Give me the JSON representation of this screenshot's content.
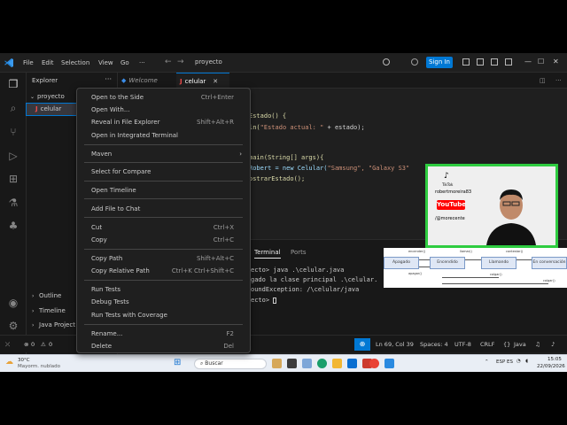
{
  "titlebar": {
    "menus": [
      "File",
      "Edit",
      "Selection",
      "View",
      "Go"
    ],
    "search_text": "proyecto",
    "sign_in": "Sign In"
  },
  "sidebar": {
    "title": "Explorer",
    "folder": "proyecto",
    "file_badge": "J",
    "file": "celular",
    "outline": "Outline",
    "timeline": "Timeline",
    "java_projects": "Java Project"
  },
  "tabs": {
    "welcome": "Welcome",
    "celular": "celular",
    "close": "✕"
  },
  "editor": {
    "lines": [
      {
        "a": "Estado() {"
      },
      {
        "a": "ln(",
        "b": "\"Estado actual: \"",
        "c": " + estado);"
      },
      {
        "a": "main(String[] args){"
      },
      {
        "a": "Robert = new Celular(",
        "b": "\"Samsung\", \"Galaxy S3\""
      },
      {
        "a": "ostrarEstado();"
      }
    ]
  },
  "panel": {
    "terminal": "Terminal",
    "ports": "Ports",
    "lines": [
      "ecto> java .\\celular.java",
      "gado la clase principal .\\celular.",
      "oundException: /\\celular/java",
      "ecto> "
    ]
  },
  "diagram": {
    "states": [
      "Apagado",
      "Encendido",
      "Llamando",
      "En conversación"
    ],
    "labels_top": [
      "encender()",
      "llamar()",
      "contestar()"
    ],
    "labels_bottom": [
      "apagar()",
      "colgar()",
      "colgar()"
    ]
  },
  "context_menu": {
    "items": [
      {
        "label": "Open to the Side",
        "shortcut": "Ctrl+Enter"
      },
      {
        "label": "Open With...",
        "shortcut": ""
      },
      {
        "label": "Reveal in File Explorer",
        "shortcut": "Shift+Alt+R"
      },
      {
        "label": "Open in Integrated Terminal",
        "shortcut": ""
      },
      {
        "label": "Maven",
        "shortcut": "",
        "submenu": "›"
      },
      {
        "label": "Select for Compare",
        "shortcut": ""
      },
      {
        "label": "Open Timeline",
        "shortcut": ""
      },
      {
        "label": "Add File to Chat",
        "shortcut": ""
      },
      {
        "label": "Cut",
        "shortcut": "Ctrl+X"
      },
      {
        "label": "Copy",
        "shortcut": "Ctrl+C"
      },
      {
        "label": "Copy Path",
        "shortcut": "Shift+Alt+C"
      },
      {
        "label": "Copy Relative Path",
        "shortcut": "Ctrl+K Ctrl+Shift+C"
      },
      {
        "label": "Run Tests",
        "shortcut": ""
      },
      {
        "label": "Debug Tests",
        "shortcut": ""
      },
      {
        "label": "Run Tests with Coverage",
        "shortcut": ""
      },
      {
        "label": "Rename...",
        "shortcut": "F2"
      },
      {
        "label": "Delete",
        "shortcut": "Del"
      }
    ]
  },
  "statusbar": {
    "errors": "0",
    "warnings": "0",
    "position": "Ln 69, Col 39",
    "spaces": "Spaces: 4",
    "encoding": "UTF-8",
    "eol": "CRLF",
    "language": "Java"
  },
  "taskbar": {
    "weather_temp": "30°C",
    "weather_desc": "Mayorm. nublado",
    "search_placeholder": "Buscar",
    "lang": "ESP ES",
    "time": "15:05",
    "date": "22/09/2026"
  },
  "webcam": {
    "tiktok_label": "TikTok",
    "tiktok_handle": "robertmoreira83",
    "youtube_label": "YouTube",
    "youtube_handle": "/@morecente"
  },
  "colors": {
    "accent": "#0078d4",
    "webcam_border": "#2ecc40"
  }
}
